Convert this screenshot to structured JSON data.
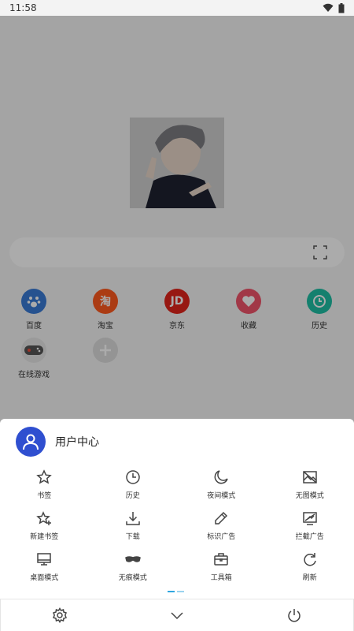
{
  "status": {
    "time": "11:58"
  },
  "shortcuts": [
    {
      "label": "百度",
      "icon": "baidu-paw-icon",
      "color": "#3a7bd5"
    },
    {
      "label": "淘宝",
      "icon_text": "淘",
      "icon": "taobao-icon",
      "color": "#ff5a1f"
    },
    {
      "label": "京东",
      "icon_text": "JD",
      "icon": "jd-icon",
      "color": "#e1251b"
    },
    {
      "label": "收藏",
      "icon": "heart-icon",
      "color": "#f0546a"
    },
    {
      "label": "历史",
      "icon": "clock-icon",
      "color": "#1fbfa5"
    },
    {
      "label": "在线游戏",
      "icon": "gamepad-icon",
      "color": "#cccccc"
    },
    {
      "label": "",
      "icon": "add-icon",
      "color": "#dddddd"
    }
  ],
  "sheet": {
    "user_title": "用户中心",
    "menu": [
      {
        "label": "书签",
        "icon": "star-icon"
      },
      {
        "label": "历史",
        "icon": "history-clock-icon"
      },
      {
        "label": "夜间模式",
        "icon": "moon-icon"
      },
      {
        "label": "无图模式",
        "icon": "no-image-icon"
      },
      {
        "label": "新建书签",
        "icon": "star-plus-icon"
      },
      {
        "label": "下载",
        "icon": "download-icon"
      },
      {
        "label": "标识广告",
        "icon": "pen-icon"
      },
      {
        "label": "拦截广告",
        "icon": "block-ad-icon"
      },
      {
        "label": "桌面模式",
        "icon": "monitor-icon"
      },
      {
        "label": "无痕模式",
        "icon": "mask-icon"
      },
      {
        "label": "工具箱",
        "icon": "toolbox-icon"
      },
      {
        "label": "刷新",
        "icon": "refresh-icon"
      }
    ]
  },
  "bottom_bar": [
    {
      "icon": "settings-gear-icon"
    },
    {
      "icon": "chevron-down-icon"
    },
    {
      "icon": "power-icon"
    }
  ]
}
